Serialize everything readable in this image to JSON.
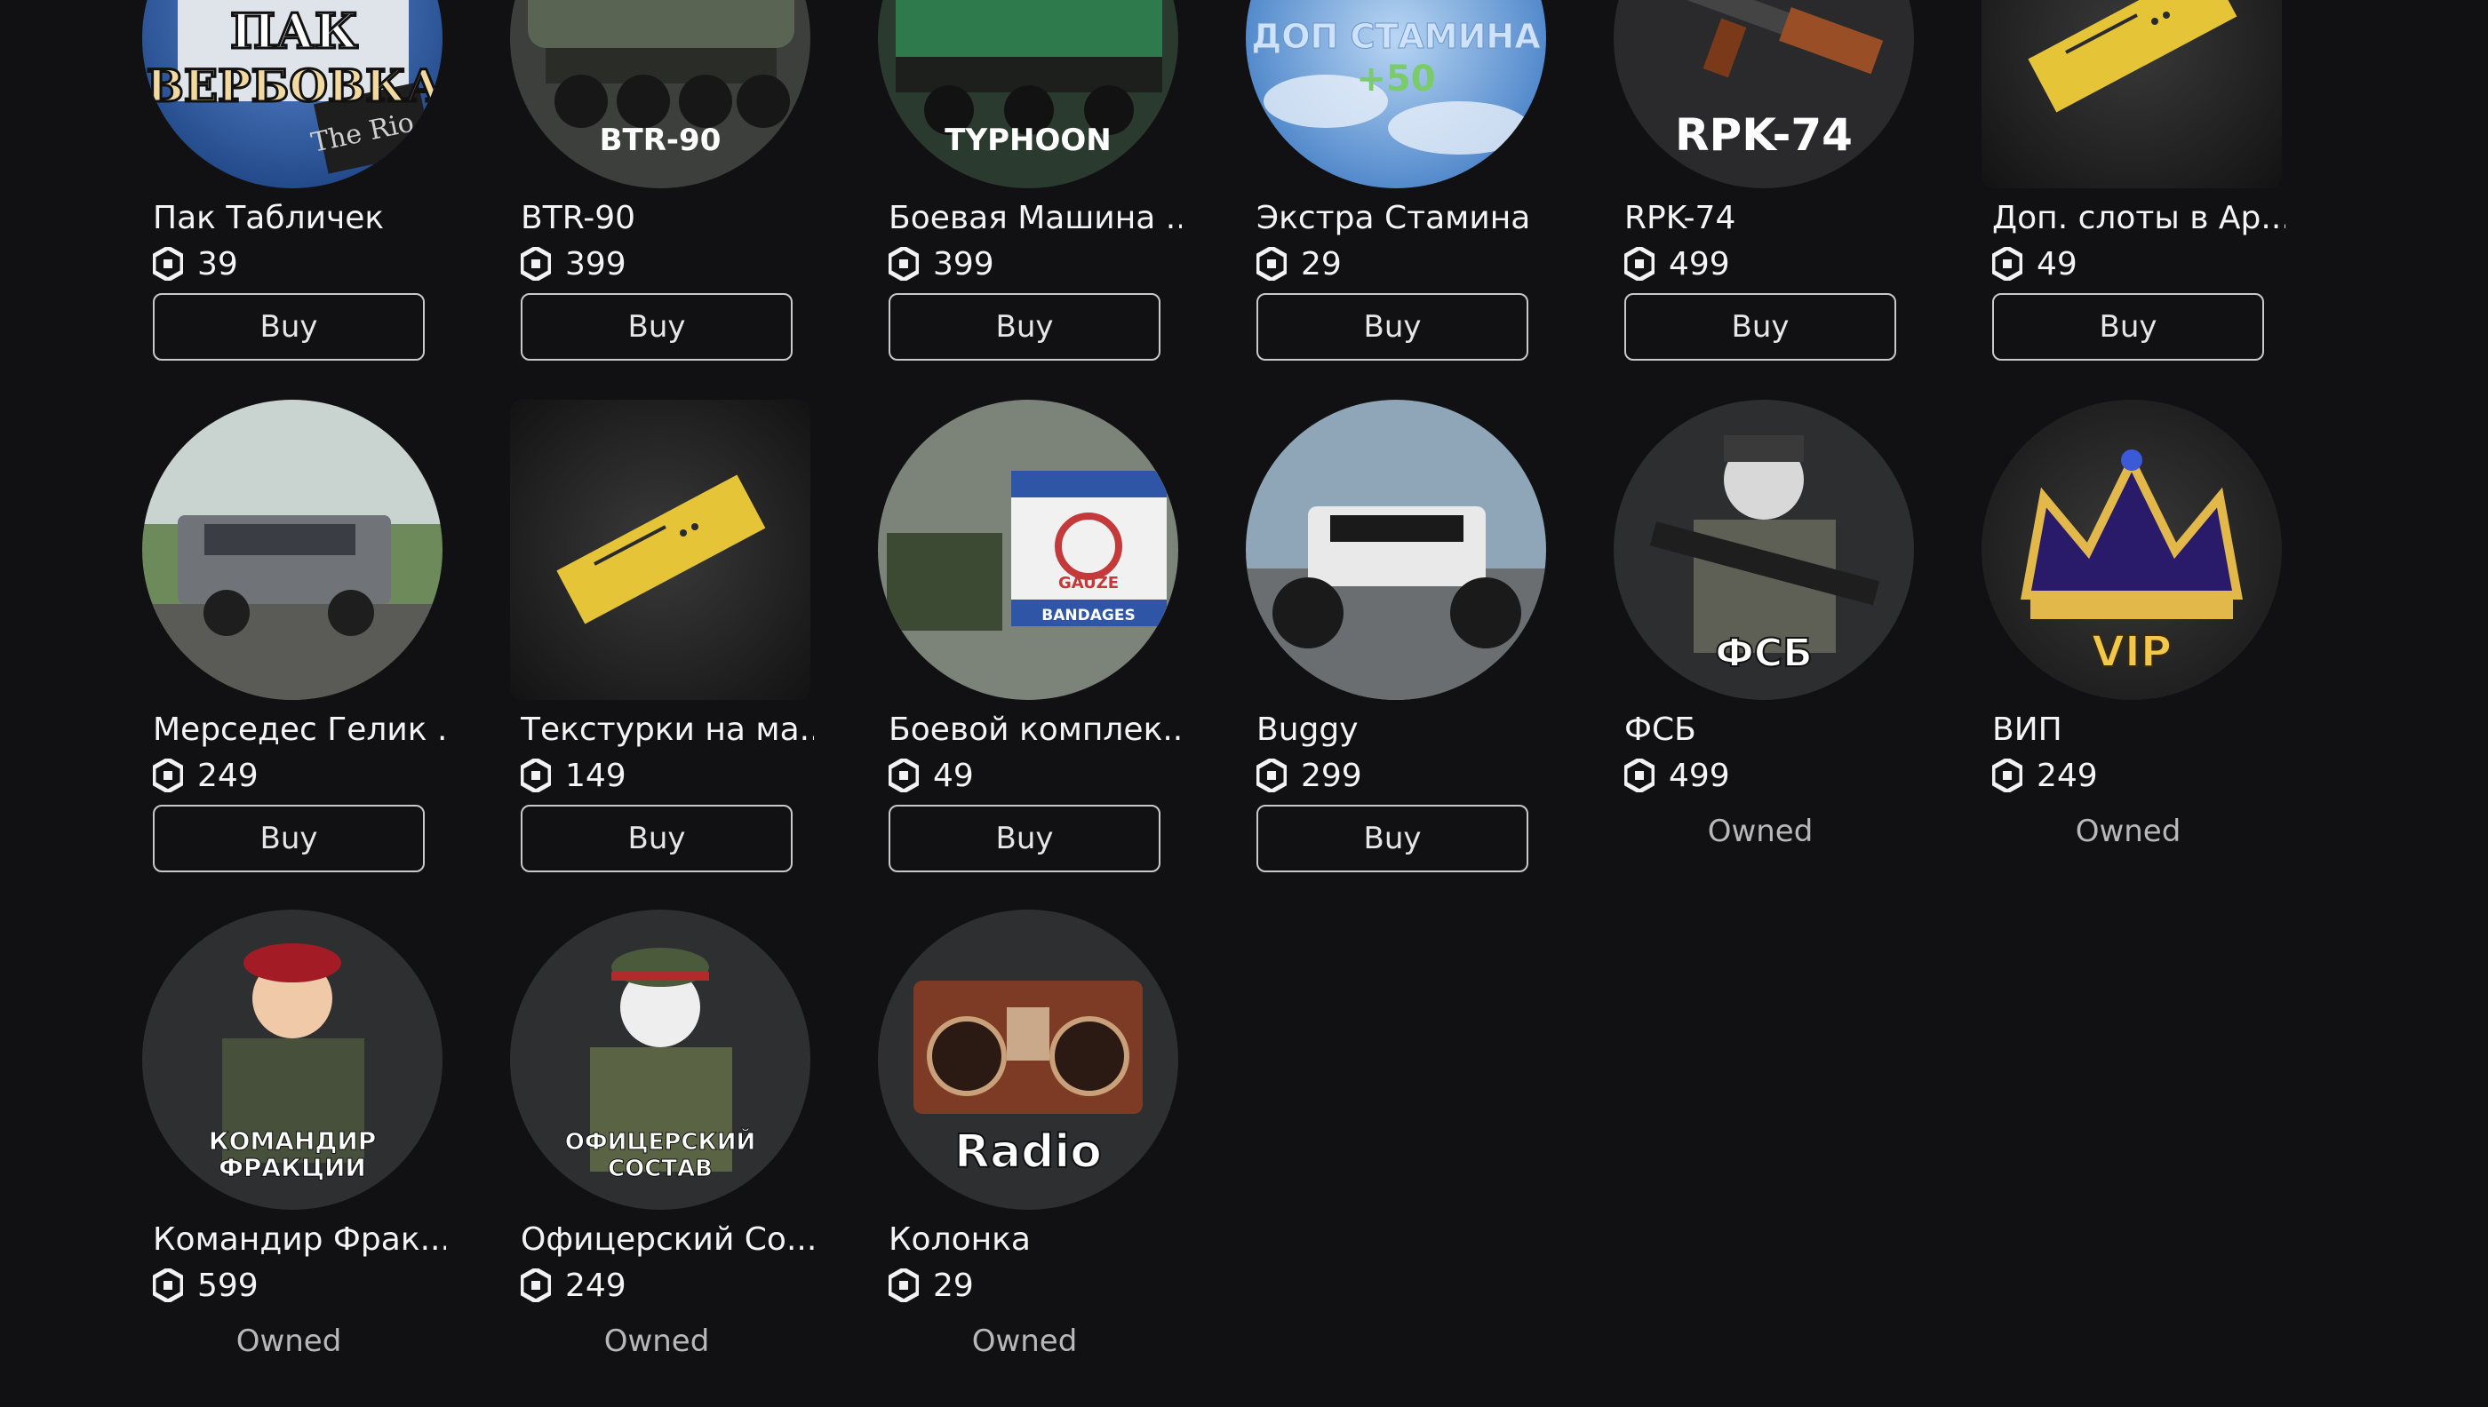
{
  "currency_icon": "robux-icon",
  "colors": {
    "background": "#111113",
    "text": "#f4f4f4",
    "button_border": "#c9c9c9",
    "owned_text": "#b8b8b8"
  },
  "items": [
    {
      "name": "Пак Табличек",
      "price": "39",
      "action": "Buy",
      "art": "Пак \"Вербовка\" The Rio"
    },
    {
      "name": "BTR-90",
      "price": "399",
      "action": "Buy",
      "art": "BTR-90"
    },
    {
      "name": "Боевая Машина ...",
      "price": "399",
      "action": "Buy",
      "art": "TYPHOON"
    },
    {
      "name": "Экстра Стамина",
      "price": "29",
      "action": "Buy",
      "art": "ДОП СТАМИНА +50"
    },
    {
      "name": "RPK-74",
      "price": "499",
      "action": "Buy",
      "art": "RPK-74"
    },
    {
      "name": "Доп. слоты в Ар...",
      "price": "49",
      "action": "Buy",
      "art": ""
    },
    {
      "name": "Мерседес Гелик ...",
      "price": "249",
      "action": "Buy",
      "art": ""
    },
    {
      "name": "Текстурки на ма...",
      "price": "149",
      "action": "Buy",
      "art": ""
    },
    {
      "name": "Боевой комплек...",
      "price": "49",
      "action": "Buy",
      "art": "GAUZE BANDAGES"
    },
    {
      "name": "Buggy",
      "price": "299",
      "action": "Buy",
      "art": ""
    },
    {
      "name": "ФСБ",
      "price": "499",
      "action": "Owned",
      "art": "ФСБ"
    },
    {
      "name": "ВИП",
      "price": "249",
      "action": "Owned",
      "art": "VIP"
    },
    {
      "name": "Командир Фрак...",
      "price": "599",
      "action": "Owned",
      "art": "КОМАНДИР ФРАКЦИИ"
    },
    {
      "name": "Офицерский Со...",
      "price": "249",
      "action": "Owned",
      "art": "ОФИЦЕРСКИЙ СОСТАВ"
    },
    {
      "name": "Колонка",
      "price": "29",
      "action": "Owned",
      "art": "Radio"
    }
  ]
}
